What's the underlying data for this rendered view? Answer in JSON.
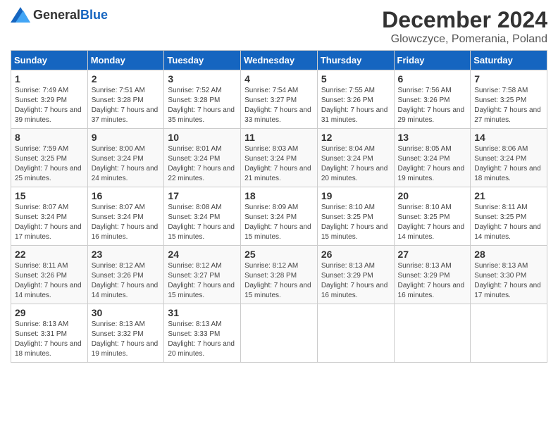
{
  "header": {
    "logo_general": "General",
    "logo_blue": "Blue",
    "month_title": "December 2024",
    "subtitle": "Glowczyce, Pomerania, Poland"
  },
  "days_of_week": [
    "Sunday",
    "Monday",
    "Tuesday",
    "Wednesday",
    "Thursday",
    "Friday",
    "Saturday"
  ],
  "weeks": [
    [
      {
        "day": "1",
        "sunrise": "7:49 AM",
        "sunset": "3:29 PM",
        "daylight": "7 hours and 39 minutes."
      },
      {
        "day": "2",
        "sunrise": "7:51 AM",
        "sunset": "3:28 PM",
        "daylight": "7 hours and 37 minutes."
      },
      {
        "day": "3",
        "sunrise": "7:52 AM",
        "sunset": "3:28 PM",
        "daylight": "7 hours and 35 minutes."
      },
      {
        "day": "4",
        "sunrise": "7:54 AM",
        "sunset": "3:27 PM",
        "daylight": "7 hours and 33 minutes."
      },
      {
        "day": "5",
        "sunrise": "7:55 AM",
        "sunset": "3:26 PM",
        "daylight": "7 hours and 31 minutes."
      },
      {
        "day": "6",
        "sunrise": "7:56 AM",
        "sunset": "3:26 PM",
        "daylight": "7 hours and 29 minutes."
      },
      {
        "day": "7",
        "sunrise": "7:58 AM",
        "sunset": "3:25 PM",
        "daylight": "7 hours and 27 minutes."
      }
    ],
    [
      {
        "day": "8",
        "sunrise": "7:59 AM",
        "sunset": "3:25 PM",
        "daylight": "7 hours and 25 minutes."
      },
      {
        "day": "9",
        "sunrise": "8:00 AM",
        "sunset": "3:24 PM",
        "daylight": "7 hours and 24 minutes."
      },
      {
        "day": "10",
        "sunrise": "8:01 AM",
        "sunset": "3:24 PM",
        "daylight": "7 hours and 22 minutes."
      },
      {
        "day": "11",
        "sunrise": "8:03 AM",
        "sunset": "3:24 PM",
        "daylight": "7 hours and 21 minutes."
      },
      {
        "day": "12",
        "sunrise": "8:04 AM",
        "sunset": "3:24 PM",
        "daylight": "7 hours and 20 minutes."
      },
      {
        "day": "13",
        "sunrise": "8:05 AM",
        "sunset": "3:24 PM",
        "daylight": "7 hours and 19 minutes."
      },
      {
        "day": "14",
        "sunrise": "8:06 AM",
        "sunset": "3:24 PM",
        "daylight": "7 hours and 18 minutes."
      }
    ],
    [
      {
        "day": "15",
        "sunrise": "8:07 AM",
        "sunset": "3:24 PM",
        "daylight": "7 hours and 17 minutes."
      },
      {
        "day": "16",
        "sunrise": "8:07 AM",
        "sunset": "3:24 PM",
        "daylight": "7 hours and 16 minutes."
      },
      {
        "day": "17",
        "sunrise": "8:08 AM",
        "sunset": "3:24 PM",
        "daylight": "7 hours and 15 minutes."
      },
      {
        "day": "18",
        "sunrise": "8:09 AM",
        "sunset": "3:24 PM",
        "daylight": "7 hours and 15 minutes."
      },
      {
        "day": "19",
        "sunrise": "8:10 AM",
        "sunset": "3:25 PM",
        "daylight": "7 hours and 15 minutes."
      },
      {
        "day": "20",
        "sunrise": "8:10 AM",
        "sunset": "3:25 PM",
        "daylight": "7 hours and 14 minutes."
      },
      {
        "day": "21",
        "sunrise": "8:11 AM",
        "sunset": "3:25 PM",
        "daylight": "7 hours and 14 minutes."
      }
    ],
    [
      {
        "day": "22",
        "sunrise": "8:11 AM",
        "sunset": "3:26 PM",
        "daylight": "7 hours and 14 minutes."
      },
      {
        "day": "23",
        "sunrise": "8:12 AM",
        "sunset": "3:26 PM",
        "daylight": "7 hours and 14 minutes."
      },
      {
        "day": "24",
        "sunrise": "8:12 AM",
        "sunset": "3:27 PM",
        "daylight": "7 hours and 15 minutes."
      },
      {
        "day": "25",
        "sunrise": "8:12 AM",
        "sunset": "3:28 PM",
        "daylight": "7 hours and 15 minutes."
      },
      {
        "day": "26",
        "sunrise": "8:13 AM",
        "sunset": "3:29 PM",
        "daylight": "7 hours and 16 minutes."
      },
      {
        "day": "27",
        "sunrise": "8:13 AM",
        "sunset": "3:29 PM",
        "daylight": "7 hours and 16 minutes."
      },
      {
        "day": "28",
        "sunrise": "8:13 AM",
        "sunset": "3:30 PM",
        "daylight": "7 hours and 17 minutes."
      }
    ],
    [
      {
        "day": "29",
        "sunrise": "8:13 AM",
        "sunset": "3:31 PM",
        "daylight": "7 hours and 18 minutes."
      },
      {
        "day": "30",
        "sunrise": "8:13 AM",
        "sunset": "3:32 PM",
        "daylight": "7 hours and 19 minutes."
      },
      {
        "day": "31",
        "sunrise": "8:13 AM",
        "sunset": "3:33 PM",
        "daylight": "7 hours and 20 minutes."
      },
      null,
      null,
      null,
      null
    ]
  ]
}
